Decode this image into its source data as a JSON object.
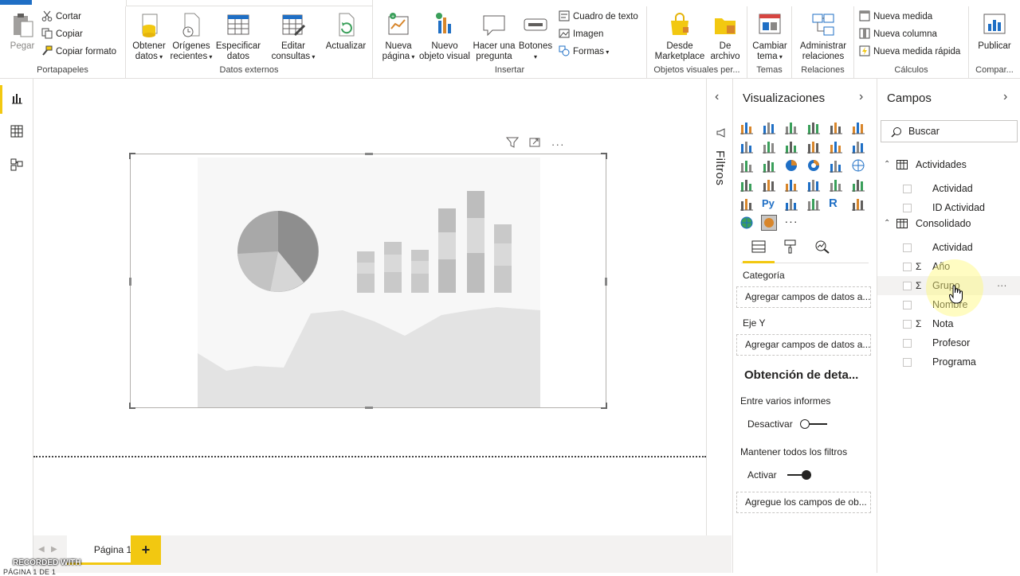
{
  "ribbon": {
    "clipboard": {
      "paste_label": "Pegar",
      "cut_label": "Cortar",
      "copy_label": "Copiar",
      "format_painter_label": "Copiar formato",
      "group_label": "Portapapeles"
    },
    "external_data": {
      "get_data_label": "Obtener\ndatos",
      "recent_sources_label": "Orígenes\nrecientes",
      "enter_data_label": "Especificar\ndatos",
      "edit_queries_label": "Editar\nconsultas",
      "refresh_label": "Actualizar",
      "group_label": "Datos externos"
    },
    "insert": {
      "new_page_label": "Nueva\npágina",
      "new_visual_label": "Nuevo\nobjeto visual",
      "ask_question_label": "Hacer una\npregunta",
      "buttons_label": "Botones",
      "text_box_label": "Cuadro de texto",
      "image_label": "Imagen",
      "shapes_label": "Formas",
      "group_label": "Insertar"
    },
    "custom_visuals": {
      "marketplace_label": "Desde\nMarketplace",
      "from_file_label": "De\narchivo",
      "group_label": "Objetos visuales per..."
    },
    "themes": {
      "switch_theme_label": "Cambiar\ntema",
      "group_label": "Temas"
    },
    "relationships": {
      "manage_label": "Administrar\nrelaciones",
      "group_label": "Relaciones"
    },
    "calculations": {
      "new_measure_label": "Nueva medida",
      "new_column_label": "Nueva columna",
      "new_quick_measure_label": "Nueva medida rápida",
      "group_label": "Cálculos"
    },
    "share": {
      "publish_label": "Publicar",
      "group_label": "Compar..."
    }
  },
  "pages": {
    "tabs": [
      {
        "label": "Página 1"
      }
    ],
    "add_label": "+",
    "status": "PÁGINA 1 DE 1",
    "watermark": "RECORDED WITH"
  },
  "filters": {
    "label": "Filtros"
  },
  "visualizations": {
    "title": "Visualizaciones",
    "more_label": "···",
    "category_label": "Categoría",
    "category_placeholder": "Agregar campos de datos a...",
    "y_axis_label": "Eje Y",
    "y_axis_placeholder": "Agregar campos de datos a...",
    "drillthrough_title": "Obtención de deta...",
    "cross_report_label": "Entre varios informes",
    "cross_report_toggle": "Desactivar",
    "keep_filters_label": "Mantener todos los filtros",
    "keep_filters_toggle": "Activar",
    "drill_fields_placeholder": "Agregue los campos de ob..."
  },
  "fields": {
    "title": "Campos",
    "search_placeholder": "Buscar",
    "tables": [
      {
        "name": "Actividades",
        "fields": [
          {
            "name": "Actividad",
            "sigma": ""
          },
          {
            "name": "ID Actividad",
            "sigma": ""
          }
        ]
      },
      {
        "name": "Consolidado",
        "fields": [
          {
            "name": "Actividad",
            "sigma": ""
          },
          {
            "name": "Año",
            "sigma": "Σ"
          },
          {
            "name": "Grupo",
            "sigma": "Σ"
          },
          {
            "name": "Nombre",
            "sigma": ""
          },
          {
            "name": "Nota",
            "sigma": "Σ"
          },
          {
            "name": "Profesor",
            "sigma": ""
          },
          {
            "name": "Programa",
            "sigma": ""
          }
        ]
      }
    ],
    "row_more": "···"
  },
  "colors": {
    "accent": "#f2c811",
    "ribbon_blue": "#1f6fc5",
    "placeholder_gray": "#c8c6c4"
  }
}
